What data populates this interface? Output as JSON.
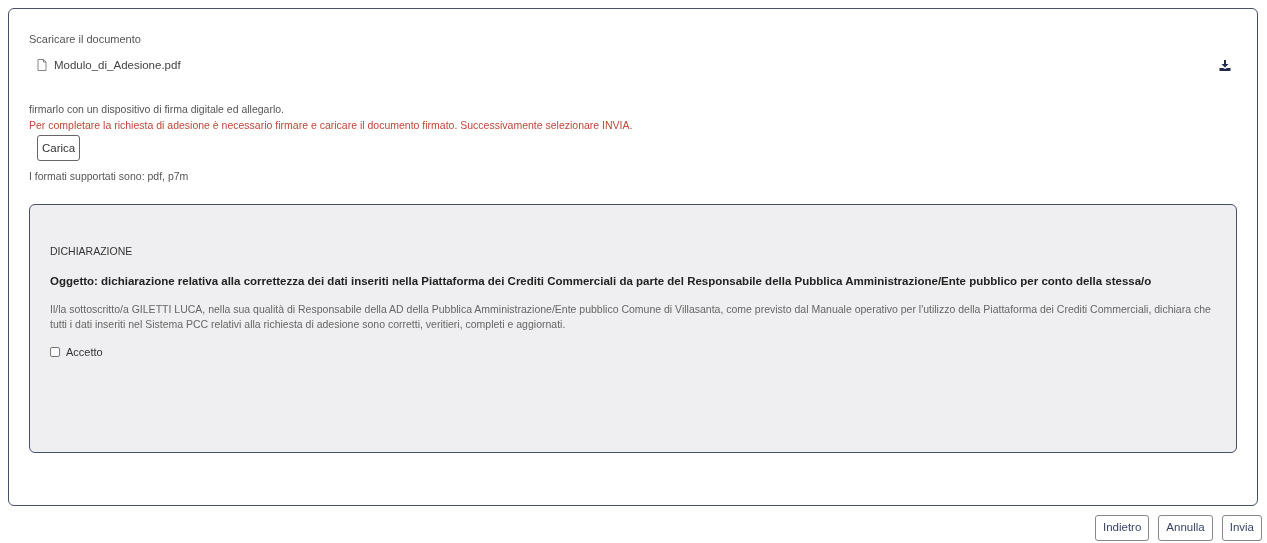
{
  "download": {
    "label": "Scaricare il documento",
    "file_name": "Modulo_di_Adesione.pdf"
  },
  "instructions": "firmarlo con un dispositivo di firma digitale ed allegarlo.",
  "warning": "Per completare la richiesta di adesione è necessario firmare e caricare il documento firmato. Successivamente selezionare INVIA.",
  "upload_button": "Carica",
  "formats_note": "I formati supportati sono: pdf, p7m",
  "declaration": {
    "title": "DICHIARAZIONE",
    "subject": "Oggetto: dichiarazione relativa alla correttezza dei dati inseriti nella Piattaforma dei Crediti Commerciali da parte del Responsabile della Pubblica Amministrazione/Ente pubblico per conto della stessa/o",
    "body": "Il/la sottoscritto/a GILETTI LUCA, nella sua qualità di Responsabile della AD della Pubblica Amministrazione/Ente pubblico Comune di Villasanta, come previsto dal Manuale operativo per l'utilizzo della Piattaforma dei Crediti Commerciali, dichiara che tutti i dati inseriti nel Sistema PCC relativi alla richiesta di adesione sono corretti, veritieri, completi e aggiornati.",
    "accept": {
      "label": "Accetto",
      "checked": false
    }
  },
  "buttons": [
    "Indietro",
    "Annulla",
    "Invia"
  ]
}
